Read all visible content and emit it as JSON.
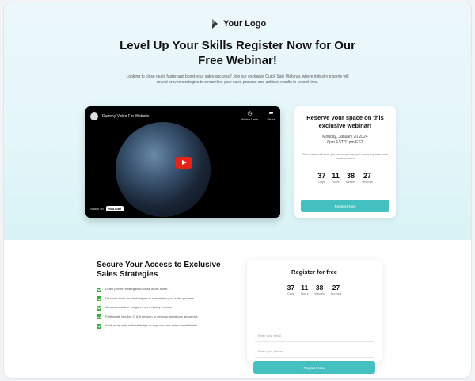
{
  "header": {
    "logo_text": "Your Logo"
  },
  "hero": {
    "title": "Level Up Your Skills Register Now for Our Free Webinar!",
    "description": "Looking to close deals faster and boost your sales success? Join our exclusive Quick Sale Webinar, where industry experts will reveal proven strategies to streamline your sales process and achieve results in record time."
  },
  "video": {
    "title": "Dummy Video For Website",
    "watch_later": "Watch Later",
    "share": "Share",
    "watch_on": "Watch on",
    "platform": "YouTube"
  },
  "reserve_card": {
    "title": "Reserve your space on this exclusive webinar!",
    "date": "Monday, January 20 2024",
    "time": "6pm EST/11pm EST",
    "note": "This session will show you how to optimize your marketing funnel and maximize sales",
    "countdown": [
      {
        "value": "37",
        "label": "Days"
      },
      {
        "value": "11",
        "label": "Hours"
      },
      {
        "value": "38",
        "label": "Minutes"
      },
      {
        "value": "27",
        "label": "Seconds"
      }
    ],
    "button_label": "Register Now"
  },
  "access": {
    "title": "Secure Your Access to Exclusive Sales Strategies",
    "benefits": [
      "Learn proven strategies to close deals faster.",
      "Discover tools and techniques to streamline your sales process.",
      "Access exclusive insights from industry experts.",
      "Participate in a live Q & A session to get your questions answered.",
      "Walk away with actionable tips to improve your sales immediately."
    ]
  },
  "register_card": {
    "title": "Register for free",
    "countdown": [
      {
        "value": "37",
        "label": "Days"
      },
      {
        "value": "11",
        "label": "Hours"
      },
      {
        "value": "38",
        "label": "Minutes"
      },
      {
        "value": "27",
        "label": "Seconds"
      }
    ],
    "email_placeholder": "Enter your email",
    "phone_placeholder": "Enter your phone",
    "button_label": "Register Now"
  },
  "colors": {
    "accent": "#44c0c1",
    "check": "#3aaa3a",
    "play": "#e62117"
  }
}
